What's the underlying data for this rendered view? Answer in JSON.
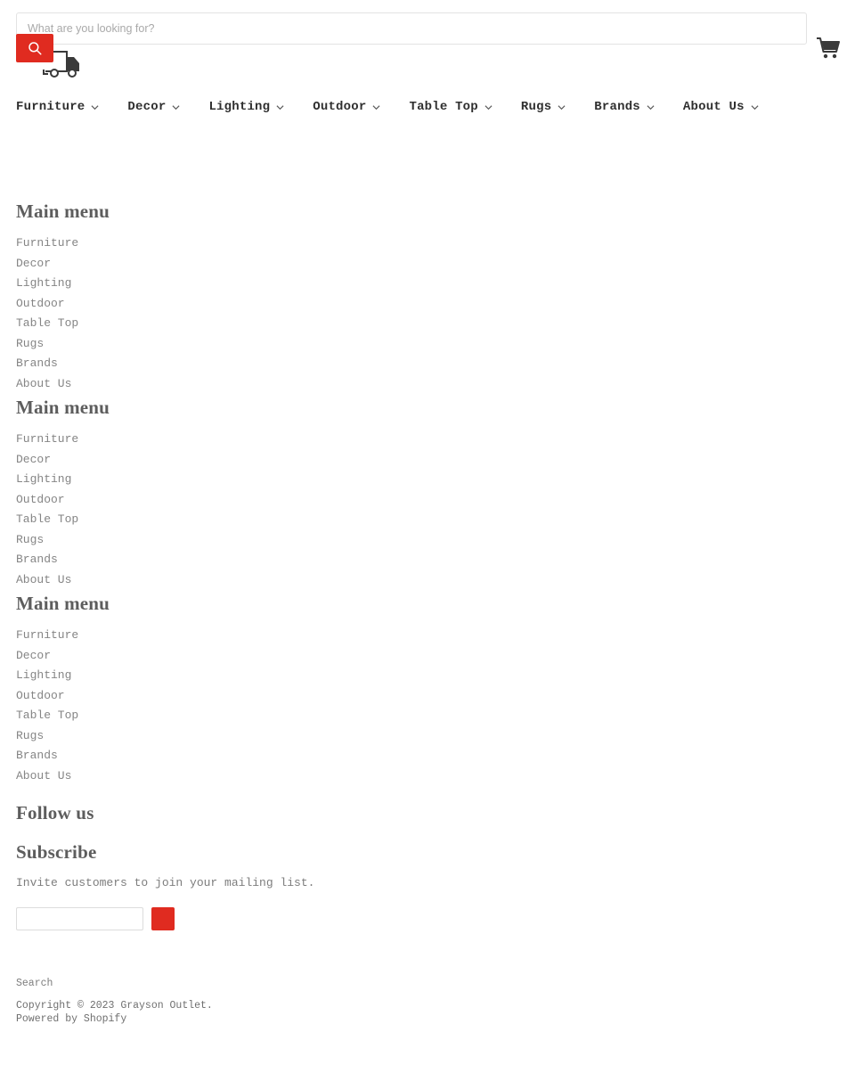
{
  "theme": {
    "accent_red": "#E02B20",
    "text_dark": "#2F2F2F",
    "text_muted": "#858585",
    "border": "#E3E3E3",
    "background": "#FFFFFF"
  },
  "header": {
    "search": {
      "placeholder": "What are you looking for?",
      "value": "",
      "submit_icon": "search-icon"
    },
    "truck_icon": "delivery-truck-icon",
    "cart": {
      "icon": "shopping-cart-icon",
      "label": "View cart"
    }
  },
  "topnav": {
    "items": [
      {
        "label": "Furniture",
        "icon": "chevron-down-icon"
      },
      {
        "label": "Decor",
        "icon": "chevron-down-icon"
      },
      {
        "label": "Lighting",
        "icon": "chevron-down-icon"
      },
      {
        "label": "Outdoor",
        "icon": "chevron-down-icon"
      },
      {
        "label": "Table Top",
        "icon": "chevron-down-icon"
      },
      {
        "label": "Rugs",
        "icon": "chevron-down-icon"
      },
      {
        "label": "Brands",
        "icon": "chevron-down-icon"
      },
      {
        "label": "About Us",
        "icon": "chevron-down-icon"
      }
    ]
  },
  "footer": {
    "menu_blocks": [
      {
        "title": "Main menu",
        "items": [
          "Furniture",
          "Decor",
          "Lighting",
          "Outdoor",
          "Table Top",
          "Rugs",
          "Brands",
          "About Us"
        ]
      },
      {
        "title": "Main menu",
        "items": [
          "Furniture",
          "Decor",
          "Lighting",
          "Outdoor",
          "Table Top",
          "Rugs",
          "Brands",
          "About Us"
        ]
      },
      {
        "title": "Main menu",
        "items": [
          "Furniture",
          "Decor",
          "Lighting",
          "Outdoor",
          "Table Top",
          "Rugs",
          "Brands",
          "About Us"
        ]
      }
    ],
    "follow": {
      "title": "Follow us"
    },
    "subscribe": {
      "title": "Subscribe",
      "description": "Invite customers to join your mailing list.",
      "input_value": "",
      "input_placeholder": "",
      "submit_label": ""
    },
    "bottom": {
      "links": [
        "Search"
      ],
      "copyright": "Copyright © 2023 Grayson Outlet.",
      "powered_prefix": "Powered by ",
      "powered_link": "Shopify"
    }
  }
}
